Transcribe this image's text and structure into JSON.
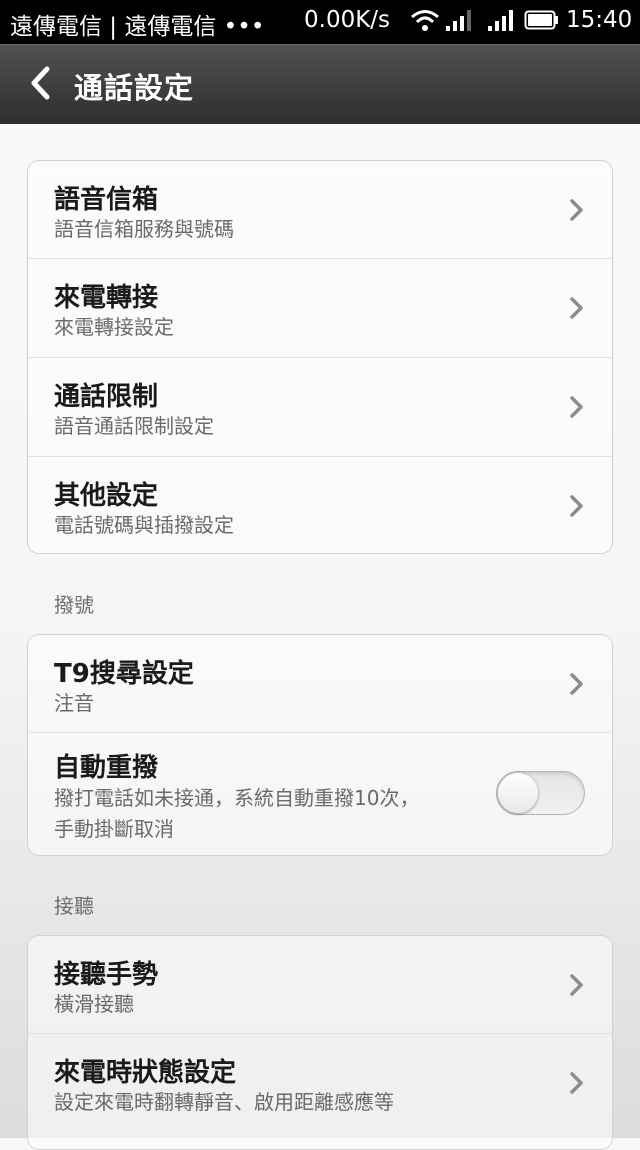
{
  "status_bar": {
    "carrier": "遠傳電信 | 遠傳電信 •••",
    "speed": "0.00K/s",
    "time": "15:40",
    "icons": [
      "wifi-icon",
      "signal-icon",
      "signal-icon",
      "battery-icon"
    ]
  },
  "header": {
    "title": "通話設定",
    "back_icon": "back-arrow-icon"
  },
  "group1": {
    "items": [
      {
        "title": "語音信箱",
        "subtitle": "語音信箱服務與號碼"
      },
      {
        "title": "來電轉接",
        "subtitle": "來電轉接設定"
      },
      {
        "title": "通話限制",
        "subtitle": "語音通話限制設定"
      },
      {
        "title": "其他設定",
        "subtitle": "電話號碼與插撥設定"
      }
    ]
  },
  "dial": {
    "header": "撥號",
    "t9": {
      "title": "T9搜尋設定",
      "subtitle": "注音"
    },
    "redial": {
      "title": "自動重撥",
      "subtitle_line1": "撥打電話如未接通，系統自動重撥10次，",
      "subtitle_line2": "手動掛斷取消",
      "enabled": false
    }
  },
  "answer": {
    "header": "接聽",
    "items": [
      {
        "title": "接聽手勢",
        "subtitle": "橫滑接聽"
      },
      {
        "title": "來電時狀態設定",
        "subtitle": "設定來電時翻轉靜音、啟用距離感應等"
      }
    ]
  }
}
